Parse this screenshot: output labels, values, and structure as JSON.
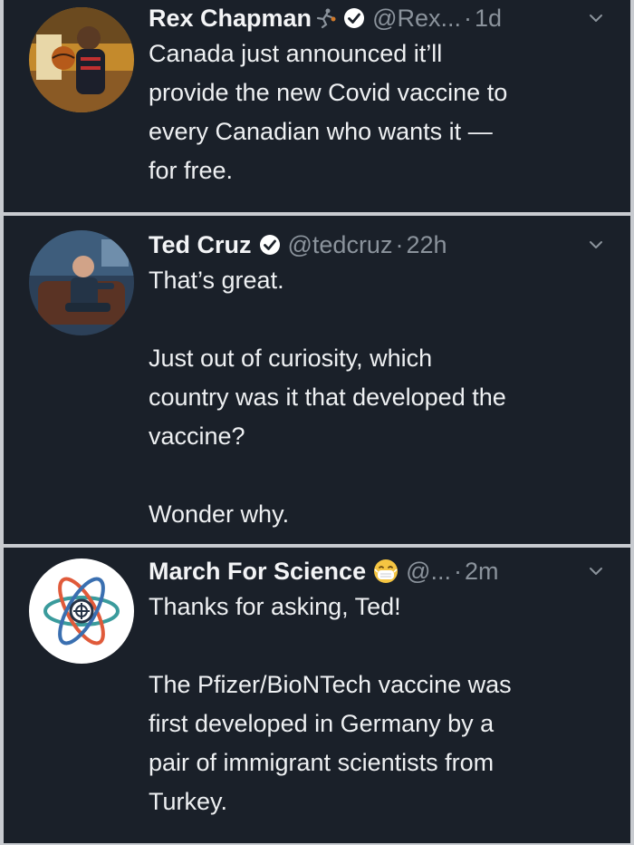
{
  "tweets": [
    {
      "name": "Rex Chapman",
      "handle": "@Rex...",
      "dot": "·",
      "time": "1d",
      "text": "Canada just announced it’ll\nprovide the new Covid vaccine to\nevery Canadian who wants it —\nfor free.",
      "verified": true,
      "name_emoji": "basketball-player-icon"
    },
    {
      "name": "Ted Cruz",
      "handle": "@tedcruz",
      "dot": "·",
      "time": "22h",
      "text": "That’s great.\n\nJust out of curiosity, which\ncountry was it that developed the\nvaccine?\n\nWonder why.",
      "verified": true
    },
    {
      "name": "March For Science",
      "handle": "@...",
      "dot": "·",
      "time": "2m",
      "text": "Thanks for asking, Ted!\n\nThe Pfizer/BioNTech vaccine was\nfirst developed in Germany by a\npair of immigrant scientists from\nTurkey.",
      "verified": false,
      "name_emoji": "face-with-medical-mask-icon"
    }
  ],
  "colors": {
    "background": "#1a2029",
    "separator": "#c8cbd0",
    "text": "#eef0f2",
    "muted": "#8b939c",
    "verified_badge": "#ffffff"
  }
}
